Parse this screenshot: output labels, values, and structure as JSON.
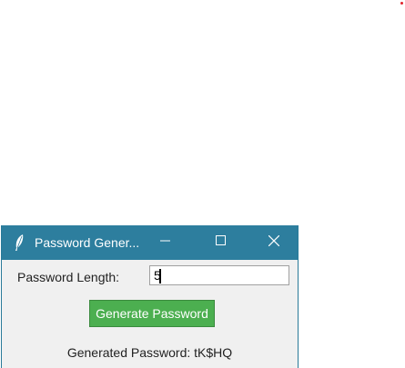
{
  "window": {
    "title": "Password Gener...",
    "app_icon": "feather-icon",
    "controls": [
      "minimize-icon",
      "maximize-icon",
      "close-icon"
    ]
  },
  "form": {
    "length_label": "Password Length:",
    "length_value": "5",
    "generate_button_label": "Generate Password",
    "result_text": "Generated Password: tK$HQ"
  },
  "colors": {
    "titlebar": "#2d7e9e",
    "button": "#4caf50",
    "window_bg": "#f0f0f0"
  }
}
